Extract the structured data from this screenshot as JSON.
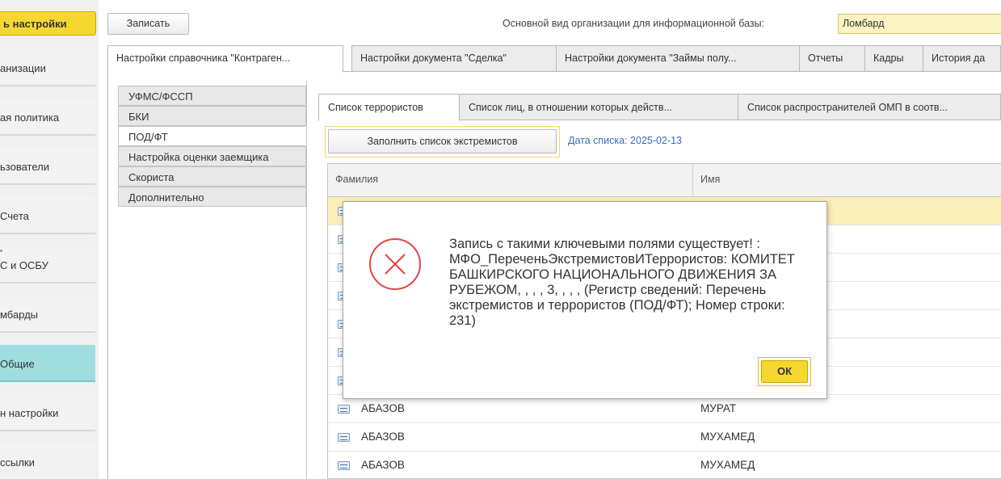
{
  "left_nav": {
    "top_button": "ь настройки",
    "items": [
      {
        "label": "анизации"
      },
      {
        "label": "ая политика"
      },
      {
        "label": "ьзователи"
      },
      {
        "label": "Счета"
      },
      {
        "label": "С и ОСБУ"
      },
      {
        "label": "мбарды"
      },
      {
        "label": "Общие"
      },
      {
        "label": "н настройки"
      },
      {
        "label": "ссылки"
      }
    ]
  },
  "toolbar": {
    "save_label": "Записать",
    "org_label": "Основной вид организации для информационной базы:",
    "org_value": "Ломбард"
  },
  "top_tabs": [
    "Настройки справочника \"Контраген...",
    "Настройки документа \"Сделка\"",
    "Настройки документа \"Займы полу...",
    "Отчеты",
    "Кадры",
    "История да"
  ],
  "side_tabs": [
    "УФМС/ФССП",
    "БКИ",
    "ПОД/ФТ",
    "Настройка оценки заемщика",
    "Скориста",
    "Дополнительно"
  ],
  "inner_tabs": [
    "Список террористов",
    "Список лиц, в отношении которых действ...",
    "Список распространителей ОМП в соотв..."
  ],
  "fill_button": "Заполнить список экстремистов",
  "date_link": "Дата списка: 2025-02-13",
  "table": {
    "headers": [
      "Фамилия",
      "Имя"
    ],
    "rows": [
      {
        "surname": "",
        "name": ""
      },
      {
        "surname": "",
        "name": ""
      },
      {
        "surname": "",
        "name": ""
      },
      {
        "surname": "",
        "name": ""
      },
      {
        "surname": "",
        "name": ""
      },
      {
        "surname": "",
        "name": ""
      },
      {
        "surname": "",
        "name": ""
      },
      {
        "surname": "АБАЗОВ",
        "name": "МУРАТ"
      },
      {
        "surname": "АБАЗОВ",
        "name": "МУХАМЕД"
      },
      {
        "surname": "АБАЗОВ",
        "name": "МУХАМЕД"
      }
    ]
  },
  "dialog": {
    "message": "Запись с такими ключевыми полями существует! : МФО_ПереченьЭкстремистовИТеррористов: КОМИТЕТ БАШКИРСКОГО НАЦИОНАЛЬНОГО ДВИЖЕНИЯ ЗА РУБЕЖОМ, , , , 3, , , ,  (Регистр сведений: Перечень экстремистов и террористов (ПОД/ФТ); Номер строки: 231)",
    "ok_label": "ОК",
    "icon": "error-icon"
  },
  "colors": {
    "accent_yellow": "#f5d730",
    "active_nav": "#9fdde0",
    "link_blue": "#3a6bb5",
    "error_red": "#e04545",
    "selected_row": "#fbefb9"
  }
}
